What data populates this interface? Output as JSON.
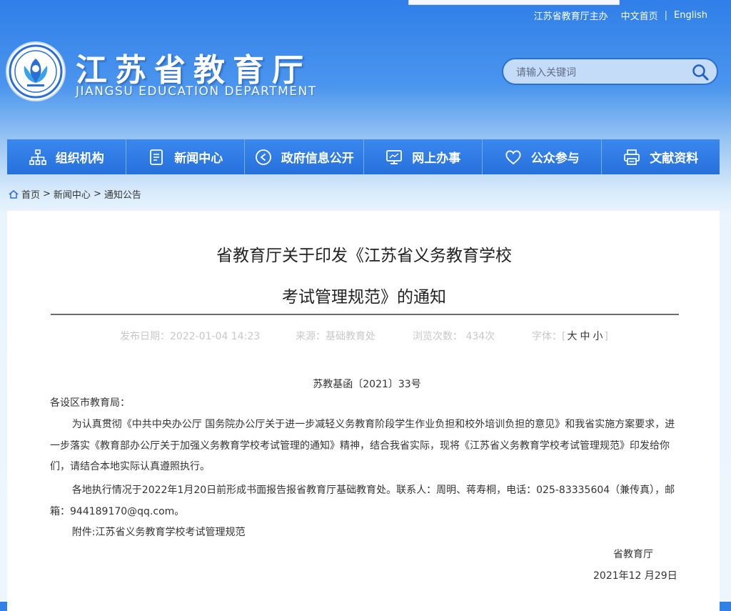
{
  "header": {
    "toplinks": [
      "江苏省教育厅主办",
      "中文首页",
      "English"
    ],
    "site_title": "江苏省教育厅",
    "site_subtitle": "JIANGSU EDUCATION DEPARTMENT",
    "search_placeholder": "请输入关键词"
  },
  "nav": [
    {
      "label": "组织机构",
      "icon": "org-chart-icon"
    },
    {
      "label": "新闻中心",
      "icon": "document-icon"
    },
    {
      "label": "政府信息公开",
      "icon": "play-circle-icon"
    },
    {
      "label": "网上办事",
      "icon": "monitor-icon"
    },
    {
      "label": "公众参与",
      "icon": "heart-icon"
    },
    {
      "label": "文献资料",
      "icon": "printer-icon"
    }
  ],
  "breadcrumb": {
    "home": "首页",
    "level1": "新闻中心",
    "level2": "通知公告"
  },
  "article": {
    "title_line1": "省教育厅关于印发《江苏省义务教育学校",
    "title_line2": "考试管理规范》的通知",
    "date_label": "发布日期：",
    "date": "2022-01-04 14:23",
    "source_label": "来源：",
    "source": "基础教育处",
    "views_label": "浏览次数：",
    "views": "434次",
    "font_label": "字体：",
    "font_sizes": [
      "大",
      "中",
      "小"
    ],
    "doc_number": "苏教基函〔2021〕33号",
    "salutation": "各设区市教育局：",
    "para1": "为认真贯彻《中共中央办公厅 国务院办公厅关于进一步减轻义务教育阶段学生作业负担和校外培训负担的意见》和我省实施方案要求，进一步落实《教育部办公厅关于加强义务教育学校考试管理的通知》精神，结合我省实际，现将《江苏省义务教育学校考试管理规范》印发给你们，请结合本地实际认真遵照执行。",
    "para2": "各地执行情况于2022年1月20日前形成书面报告报省教育厅基础教育处。联系人：周明、蒋寿桐，电话：025-83335604（兼传真），邮箱：944189170@qq.com。",
    "attachment": "附件:江苏省义务教育学校考试管理规范",
    "signer": "省教育厅",
    "sign_date": "2021年12 月29日"
  }
}
